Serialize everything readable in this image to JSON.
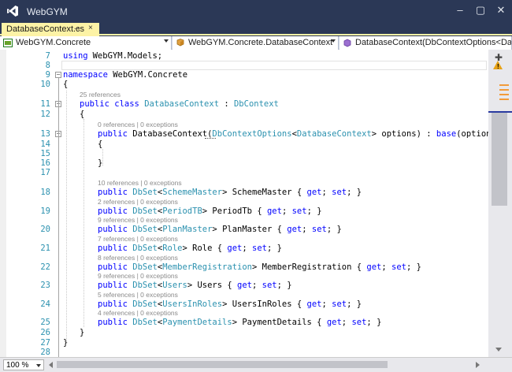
{
  "window": {
    "title": "WebGYM"
  },
  "tab": {
    "label": "DatabaseContext.cs",
    "pin": "⊸",
    "close": "×"
  },
  "nav": {
    "project": "WebGYM.Concrete",
    "type": "WebGYM.Concrete.DatabaseContext",
    "member": "DatabaseContext(DbContextOptions<Data"
  },
  "editor": {
    "zoom": "100 %",
    "lines": [
      {
        "n": "7",
        "parts": [
          [
            "kw",
            "using"
          ],
          [
            "",
            "WebGYM.Models;"
          ]
        ]
      },
      {
        "n": "8",
        "parts": []
      },
      {
        "n": "9",
        "parts": [
          [
            "kw",
            "namespace"
          ],
          [
            "",
            " WebGYM.Concrete"
          ]
        ]
      },
      {
        "n": "10",
        "parts": [
          [
            "",
            "{"
          ]
        ]
      },
      {
        "n": "11",
        "lens": "25 references",
        "parts": [
          [
            "kw",
            "public class "
          ],
          [
            "ty",
            "DatabaseContext"
          ],
          [
            "",
            " : "
          ],
          [
            "ty",
            "DbContext"
          ]
        ]
      },
      {
        "n": "12",
        "parts": [
          [
            "",
            "{"
          ]
        ]
      },
      {
        "n": "13",
        "lens": "0 references | 0 exceptions",
        "parts": [
          [
            "kw",
            "public "
          ],
          [
            "",
            "DatabaseContext("
          ],
          [
            "ty",
            "DbContextOptions"
          ],
          [
            "",
            "<"
          ],
          [
            "ty",
            "DatabaseContext"
          ],
          [
            "",
            "> options) : "
          ],
          [
            "kw",
            "base"
          ],
          [
            "",
            "(options)"
          ]
        ]
      },
      {
        "n": "14",
        "parts": [
          [
            "",
            "{"
          ]
        ]
      },
      {
        "n": "15",
        "parts": []
      },
      {
        "n": "16",
        "parts": [
          [
            "",
            "}"
          ]
        ]
      },
      {
        "n": "17",
        "parts": []
      },
      {
        "n": "18",
        "lens": "10 references | 0 exceptions",
        "parts": [
          [
            "kw",
            "public "
          ],
          [
            "ty",
            "DbSet"
          ],
          [
            "",
            "<"
          ],
          [
            "ty",
            "SchemeMaster"
          ],
          [
            "",
            "> SchemeMaster { "
          ],
          [
            "kw",
            "get"
          ],
          [
            "",
            "; "
          ],
          [
            "kw",
            "set"
          ],
          [
            "",
            "; }"
          ]
        ]
      },
      {
        "n": "19",
        "lens": "2 references | 0 exceptions",
        "parts": [
          [
            "kw",
            "public "
          ],
          [
            "ty",
            "DbSet"
          ],
          [
            "",
            "<"
          ],
          [
            "ty",
            "PeriodTB"
          ],
          [
            "",
            "> PeriodTb { "
          ],
          [
            "kw",
            "get"
          ],
          [
            "",
            "; "
          ],
          [
            "kw",
            "set"
          ],
          [
            "",
            "; }"
          ]
        ]
      },
      {
        "n": "20",
        "lens": "9 references | 0 exceptions",
        "parts": [
          [
            "kw",
            "public "
          ],
          [
            "ty",
            "DbSet"
          ],
          [
            "",
            "<"
          ],
          [
            "ty",
            "PlanMaster"
          ],
          [
            "",
            "> PlanMaster { "
          ],
          [
            "kw",
            "get"
          ],
          [
            "",
            "; "
          ],
          [
            "kw",
            "set"
          ],
          [
            "",
            "; }"
          ]
        ]
      },
      {
        "n": "21",
        "lens": "7 references | 0 exceptions",
        "parts": [
          [
            "kw",
            "public "
          ],
          [
            "ty",
            "DbSet"
          ],
          [
            "",
            "<"
          ],
          [
            "ty",
            "Role"
          ],
          [
            "",
            "> Role { "
          ],
          [
            "kw",
            "get"
          ],
          [
            "",
            "; "
          ],
          [
            "kw",
            "set"
          ],
          [
            "",
            "; }"
          ]
        ]
      },
      {
        "n": "22",
        "lens": "8 references | 0 exceptions",
        "parts": [
          [
            "kw",
            "public "
          ],
          [
            "ty",
            "DbSet"
          ],
          [
            "",
            "<"
          ],
          [
            "ty",
            "MemberRegistration"
          ],
          [
            "",
            "> MemberRegistration { "
          ],
          [
            "kw",
            "get"
          ],
          [
            "",
            "; "
          ],
          [
            "kw",
            "set"
          ],
          [
            "",
            "; }"
          ]
        ]
      },
      {
        "n": "23",
        "lens": "9 references | 0 exceptions",
        "parts": [
          [
            "kw",
            "public "
          ],
          [
            "ty",
            "DbSet"
          ],
          [
            "",
            "<"
          ],
          [
            "ty",
            "Users"
          ],
          [
            "",
            "> Users { "
          ],
          [
            "kw",
            "get"
          ],
          [
            "",
            "; "
          ],
          [
            "kw",
            "set"
          ],
          [
            "",
            "; }"
          ]
        ]
      },
      {
        "n": "24",
        "lens": "5 references | 0 exceptions",
        "parts": [
          [
            "kw",
            "public "
          ],
          [
            "ty",
            "DbSet"
          ],
          [
            "",
            "<"
          ],
          [
            "ty",
            "UsersInRoles"
          ],
          [
            "",
            "> UsersInRoles { "
          ],
          [
            "kw",
            "get"
          ],
          [
            "",
            "; "
          ],
          [
            "kw",
            "set"
          ],
          [
            "",
            "; }"
          ]
        ]
      },
      {
        "n": "25",
        "lens": "4 references | 0 exceptions",
        "parts": [
          [
            "kw",
            "public "
          ],
          [
            "ty",
            "DbSet"
          ],
          [
            "",
            "<"
          ],
          [
            "ty",
            "PaymentDetails"
          ],
          [
            "",
            "> PaymentDetails { "
          ],
          [
            "kw",
            "get"
          ],
          [
            "",
            "; "
          ],
          [
            "kw",
            "set"
          ],
          [
            "",
            "; }"
          ]
        ]
      },
      {
        "n": "26",
        "parts": [
          [
            "",
            "}"
          ]
        ]
      },
      {
        "n": "27",
        "parts": [
          [
            "",
            "}"
          ]
        ]
      },
      {
        "n": "28",
        "parts": []
      }
    ]
  },
  "colors": {
    "keyword": "#0000ff",
    "type": "#2b91af",
    "tab_active": "#fdf3a6",
    "chrome": "#2b3856"
  },
  "icons": [
    "vs-logo-icon",
    "pin-icon",
    "close-icon",
    "csharp-project-icon",
    "class-icon",
    "method-icon",
    "split-icon",
    "warning-icon"
  ]
}
